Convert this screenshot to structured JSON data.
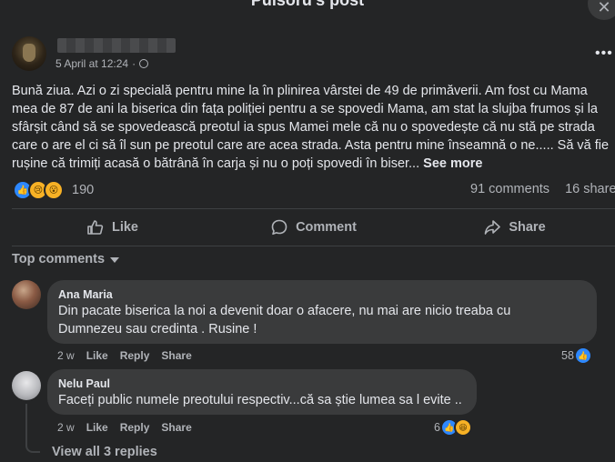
{
  "dialog": {
    "title": "Pulsoru's post",
    "close_label": "✕"
  },
  "post": {
    "timestamp": "5 April at 12:24",
    "dot": "·",
    "more_label": "•••",
    "text_lines": [
      "Bună ziua. Azi o zi specială pentru mine la în plinirea vârstei de 49 de primăverii. Am fost cu Mama",
      "mea de 87 de ani la biserica din fața poliției pentru a se spovedi Mama, am stat la slujba frumos și la",
      "sfârșit când să se spovedească preotul ia spus Mamei mele că nu o spovedește că nu stă pe strada",
      "care o are el ci să îl sun pe preotul care are acea strada. Asta pentru mine înseamnă o ne..... Să vă fie",
      "rușine că trimiți acasă o bătrână în carja și nu o poți spovedi în biser..."
    ],
    "see_more": "See more",
    "reaction_count": "190",
    "comments_count": "91 comments",
    "shares_count": "16 shares"
  },
  "actions": {
    "like": "Like",
    "comment": "Comment",
    "share": "Share"
  },
  "comments_filter": "Top comments",
  "comments": [
    {
      "author": "Ana Maria",
      "lines": [
        "Din pacate biserica la noi a devenit doar o afacere, nu mai are nicio treaba cu",
        "Dumnezeu sau credinta . Rusine !"
      ],
      "age": "2 w",
      "like": "Like",
      "reply": "Reply",
      "share": "Share",
      "reactions": "58"
    },
    {
      "author": "Nelu Paul",
      "lines": [
        "Faceți public numele preotului respectiv...că sa știe lumea sa l evite .."
      ],
      "age": "2 w",
      "like": "Like",
      "reply": "Reply",
      "share": "Share",
      "reactions": "6"
    }
  ],
  "view_replies": "View all 3 replies",
  "colors": {
    "background": "#242526",
    "bubble": "#3a3b3c",
    "accent": "#2d88ff",
    "text": "#e4e6eb",
    "muted": "#b0b3b8"
  }
}
